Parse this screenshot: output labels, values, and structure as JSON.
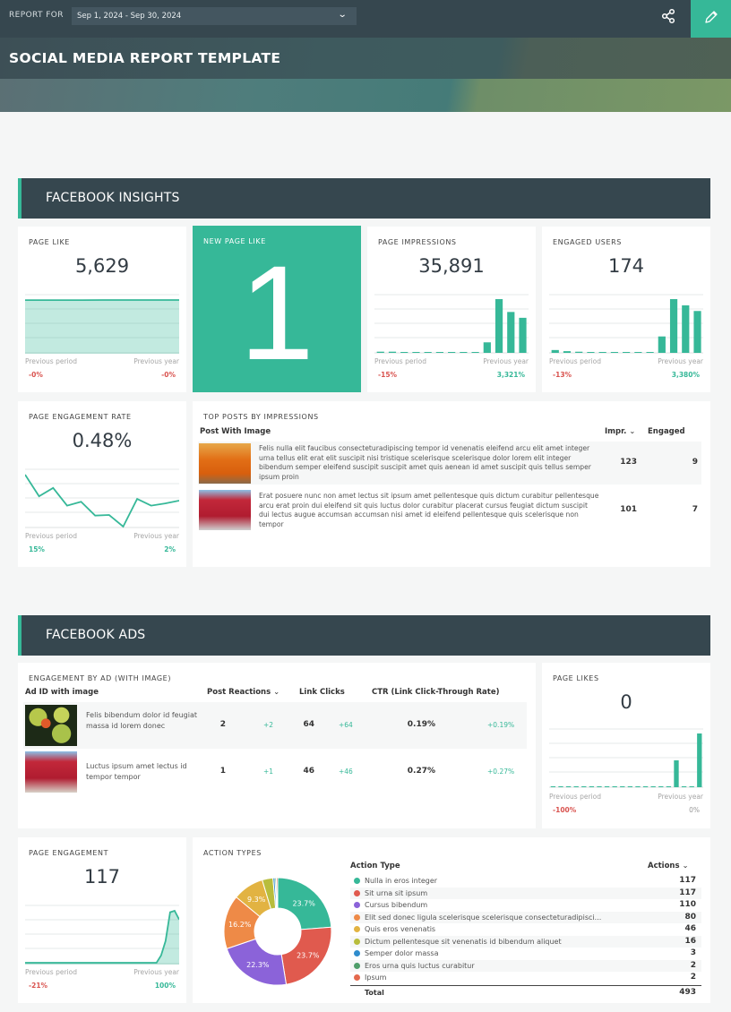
{
  "header": {
    "report_for_label": "REPORT FOR",
    "date_range": "Sep 1, 2024 - Sep 30, 2024",
    "title": "SOCIAL MEDIA REPORT TEMPLATE",
    "share_icon": "share-icon",
    "edit_icon": "pencil-icon"
  },
  "colors": {
    "accent": "#36b898",
    "header_dark": "#36474f",
    "negative": "#d9534f"
  },
  "sections": {
    "insights": "FACEBOOK INSIGHTS",
    "ads": "FACEBOOK ADS"
  },
  "common": {
    "previous_period": "Previous period",
    "previous_year": "Previous year"
  },
  "page_like": {
    "title": "PAGE LIKE",
    "value": "5,629",
    "prev_period": "-0%",
    "prev_year": "-0%",
    "series": [
      5620,
      5622,
      5623,
      5624,
      5625,
      5626,
      5627,
      5628,
      5629
    ]
  },
  "new_page_like": {
    "title": "NEW PAGE LIKE",
    "value": "1"
  },
  "page_impressions": {
    "title": "PAGE IMPRESSIONS",
    "value": "35,891",
    "prev_period": "-15%",
    "prev_year": "3,321%",
    "series": [
      2,
      2,
      1,
      1,
      0,
      0,
      0,
      0,
      0,
      18,
      92,
      70,
      60
    ]
  },
  "engaged_users": {
    "title": "ENGAGED USERS",
    "value": "174",
    "prev_period": "-13%",
    "prev_year": "3,380%",
    "series": [
      5,
      3,
      2,
      0,
      1,
      0,
      0,
      0,
      0,
      29,
      95,
      84,
      74
    ]
  },
  "engagement_rate": {
    "title": "PAGE ENGAGEMENT RATE",
    "value": "0.48%",
    "prev_period": "15%",
    "prev_year": "2%",
    "series": [
      0.94,
      0.55,
      0.7,
      0.38,
      0.45,
      0.2,
      0.21,
      0.0,
      0.5,
      0.38,
      0.42,
      0.47
    ]
  },
  "top_posts": {
    "title": "TOP POSTS BY IMPRESSIONS",
    "columns": [
      "Post With Image",
      "Impr.",
      "Engaged"
    ],
    "rows": [
      {
        "image": "orange-tree-photo",
        "text": "Felis nulla elit faucibus consecteturadipiscing tempor id venenatis eleifend arcu elit amet integer urna tellus elit erat elit suscipit nisi tristique scelerisque scelerisque dolor lorem elit integer bibendum semper eleifend suscipit suscipit amet quis aenean id amet suscipit quis tellus semper ipsum proin",
        "impr": "123",
        "engaged": "9"
      },
      {
        "image": "red-tree-photo",
        "text": "Erat posuere nunc non amet lectus sit ipsum amet pellentesque quis dictum curabitur pellentesque arcu erat proin dui eleifend sit quis luctus dolor curabitur placerat cursus feugiat dictum suscipit dui lectus augue accumsan accumsan nisi amet id eleifend pellentesque quis scelerisque non tempor",
        "impr": "101",
        "engaged": "7"
      }
    ]
  },
  "engagement_by_ad": {
    "title": "ENGAGEMENT BY AD (WITH IMAGE)",
    "columns": [
      "Ad ID with image",
      "Post Reactions",
      "Link Clicks",
      "CTR (Link Click-Through Rate)"
    ],
    "rows": [
      {
        "image": "leaves-photo",
        "text": "Felis bibendum dolor id feugiat massa id lorem donec",
        "reactions": "2",
        "reactions_delta": "+2",
        "clicks": "64",
        "clicks_delta": "+64",
        "ctr": "0.19%",
        "ctr_delta": "+0.19%"
      },
      {
        "image": "red-tree-photo",
        "text": "Luctus ipsum amet lectus id tempor tempor",
        "reactions": "1",
        "reactions_delta": "+1",
        "clicks": "46",
        "clicks_delta": "+46",
        "ctr": "0.27%",
        "ctr_delta": "+0.27%"
      }
    ]
  },
  "page_likes": {
    "title": "PAGE LIKES",
    "value": "0",
    "prev_period": "-100%",
    "prev_year": "0%",
    "series": [
      0,
      0,
      0,
      0,
      0,
      0,
      0,
      0,
      0,
      0,
      0,
      0,
      0,
      0,
      0,
      0,
      1,
      0,
      0,
      2
    ]
  },
  "page_engagement": {
    "title": "PAGE ENGAGEMENT",
    "value": "117",
    "prev_period": "-21%",
    "prev_year": "100%",
    "series": [
      0,
      0,
      0,
      0,
      0,
      0,
      0,
      0,
      0,
      0,
      0,
      0,
      0,
      0,
      0,
      0,
      0,
      0,
      0,
      0,
      0,
      0,
      0,
      0,
      0,
      0,
      0,
      0,
      0,
      0,
      1,
      3,
      7,
      7.2,
      6
    ]
  },
  "chart_data": {
    "type": "pie",
    "title": "ACTION TYPES",
    "columns": [
      "Action Type",
      "Actions"
    ],
    "categories": [
      "Nulla in eros integer",
      "Sit urna sit ipsum",
      "Cursus bibendum",
      "Elit sed donec ligula scelerisque scelerisque consecteturadipisci...",
      "Quis eros venenatis",
      "Dictum pellentesque sit venenatis id bibendum aliquet",
      "Semper dolor massa",
      "Eros urna quis luctus curabitur",
      "Ipsum"
    ],
    "values": [
      117,
      117,
      110,
      80,
      46,
      16,
      3,
      2,
      2
    ],
    "colors": [
      "#36b898",
      "#e05a4e",
      "#8b63d9",
      "#ee8a47",
      "#e2b342",
      "#b8bd3c",
      "#2f8ccd",
      "#4f9e6a",
      "#e4694d"
    ],
    "labels": [
      "23.7%",
      "23.7%",
      "22.3%",
      "16.2%",
      "9.3%",
      "",
      "",
      "",
      ""
    ],
    "total_label": "Total",
    "total": "493",
    "donut": true
  }
}
